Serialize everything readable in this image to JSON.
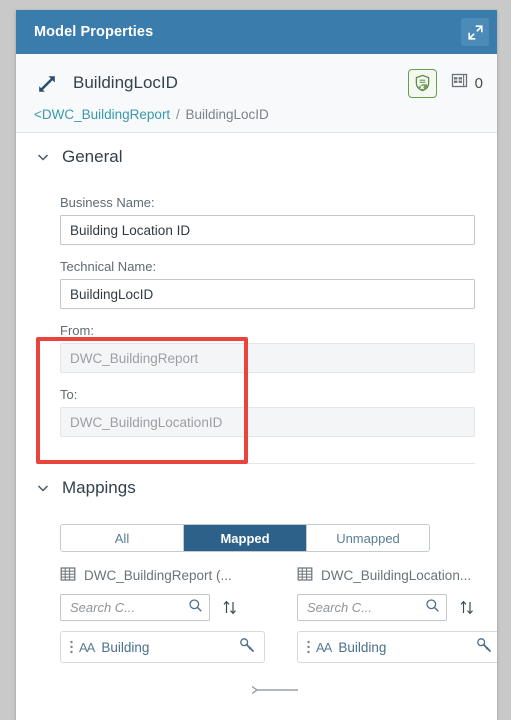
{
  "window": {
    "title": "Model Properties",
    "expand_icon": "expand-icon",
    "header_color": "#3a7dad"
  },
  "object_header": {
    "icon": "association-arrow-icon",
    "name": "BuildingLocID",
    "validation_icon": "shield-check-icon",
    "validation_color": "#6a9b4f",
    "records_icon": "table-icon",
    "records_count": "0",
    "breadcrumb": {
      "parent": "<DWC_BuildingReport",
      "separator": "/",
      "current": "BuildingLocID",
      "link_color": "#3a9aad"
    }
  },
  "general": {
    "title": "General",
    "chevron": "chevron-down-icon",
    "fields": [
      {
        "label": "Business Name:",
        "value": "Building Location ID",
        "disabled": false
      },
      {
        "label": "Technical Name:",
        "value": "BuildingLocID",
        "disabled": false
      },
      {
        "label": "From:",
        "value": "DWC_BuildingReport",
        "disabled": true
      },
      {
        "label": "To:",
        "value": "DWC_BuildingLocationID",
        "disabled": true
      }
    ]
  },
  "annotation": {
    "type": "red-highlight-rectangle",
    "color": "#e8443c"
  },
  "mappings": {
    "title": "Mappings",
    "chevron": "chevron-down-icon",
    "filter_tabs": [
      {
        "label": "All",
        "selected": false
      },
      {
        "label": "Mapped",
        "selected": true
      },
      {
        "label": "Unmapped",
        "selected": false
      }
    ],
    "selected_color": "#2d6189",
    "source": {
      "icon": "table-icon",
      "title": "DWC_BuildingReport (...",
      "search_placeholder": "Search C...",
      "search_icon": "magnifier-icon",
      "sort_icon": "sort-icon",
      "items": [
        {
          "grip": "drag-handle-icon",
          "type_icon": "AA",
          "label": "Building",
          "key_icon": "key-icon"
        }
      ]
    },
    "target": {
      "icon": "table-icon",
      "title": "DWC_BuildingLocation...",
      "search_placeholder": "Search C...",
      "search_icon": "magnifier-icon",
      "sort_icon": "sort-icon",
      "items": [
        {
          "grip": "drag-handle-icon",
          "type_icon": "AA",
          "label": "Building",
          "key_icon": "key-icon"
        }
      ]
    }
  }
}
